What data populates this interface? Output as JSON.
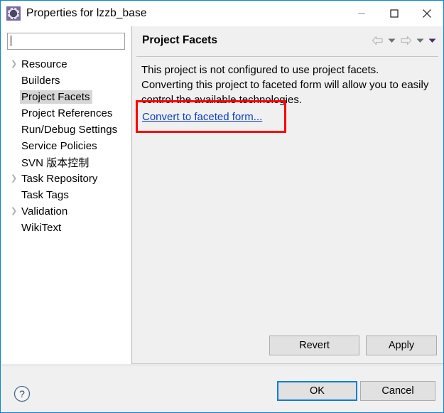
{
  "window": {
    "title": "Properties for lzzb_base",
    "icon": "gear-icon",
    "controls": {
      "minimize": "—",
      "maximize": "□",
      "close": "✕"
    },
    "border_color": "#0a84d8"
  },
  "sidebar": {
    "filter": {
      "value": "",
      "placeholder": ""
    },
    "items": [
      {
        "label": "Resource",
        "expandable": true,
        "selected": false
      },
      {
        "label": "Builders",
        "expandable": false,
        "selected": false
      },
      {
        "label": "Project Facets",
        "expandable": false,
        "selected": true
      },
      {
        "label": "Project References",
        "expandable": false,
        "selected": false
      },
      {
        "label": "Run/Debug Settings",
        "expandable": false,
        "selected": false
      },
      {
        "label": "Service Policies",
        "expandable": false,
        "selected": false
      },
      {
        "label": "SVN 版本控制",
        "expandable": false,
        "selected": false
      },
      {
        "label": "Task Repository",
        "expandable": true,
        "selected": false
      },
      {
        "label": "Task Tags",
        "expandable": false,
        "selected": false
      },
      {
        "label": "Validation",
        "expandable": true,
        "selected": false
      },
      {
        "label": "WikiText",
        "expandable": false,
        "selected": false
      }
    ],
    "scrollbar": {
      "left_arrow": "‹",
      "right_arrow": "›"
    }
  },
  "panel": {
    "title": "Project Facets",
    "nav": {
      "back": "back-arrow-icon",
      "back_menu": "chevron-down-icon",
      "forward": "forward-arrow-icon",
      "forward_menu": "chevron-down-icon",
      "view_menu": "view-menu-icon"
    },
    "description": "This project is not configured to use project facets. Converting this project to faceted form will allow you to easily control the available technologies.",
    "link_label": "Convert to faceted form...",
    "link_color": "#0b3fbf",
    "highlight_color": "#ff0000",
    "buttons": {
      "revert": "Revert",
      "apply": "Apply"
    }
  },
  "footer": {
    "help": "?",
    "ok": "OK",
    "cancel": "Cancel",
    "focus_color": "#0a7fd8"
  }
}
